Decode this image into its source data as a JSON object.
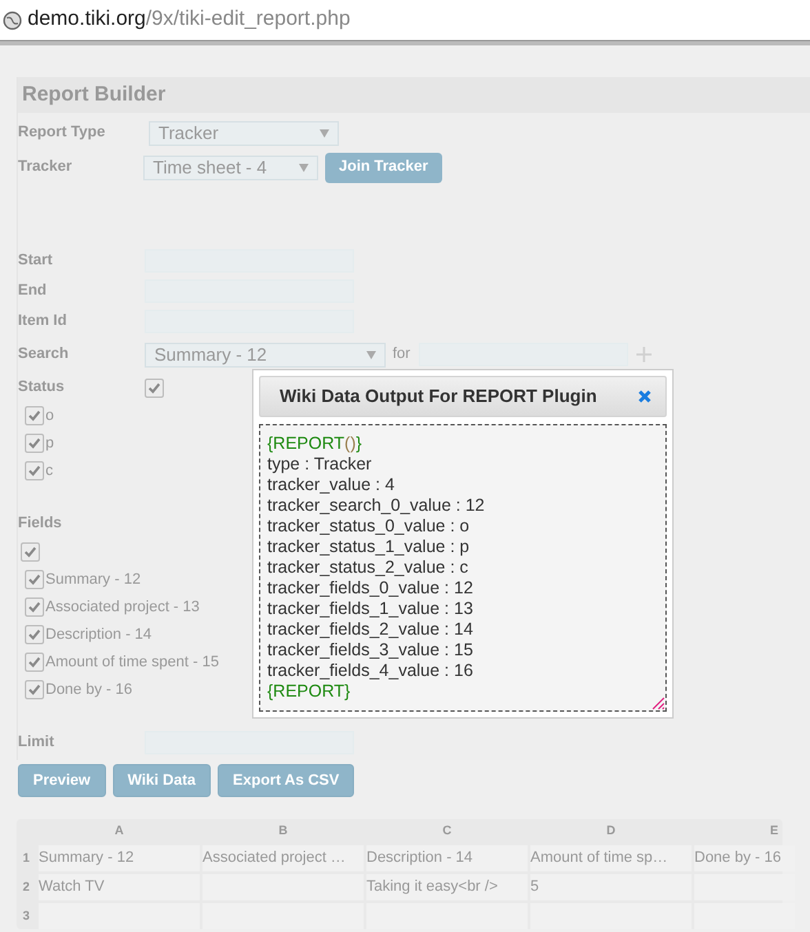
{
  "browser": {
    "url_host": "demo.tiki.org",
    "url_path": "/9x/tiki-edit_report.php"
  },
  "report_builder": {
    "title": "Report Builder",
    "sections": [
      [
        {
          "kind": "select",
          "label": "Report Type",
          "value": "Tracker"
        },
        {
          "kind": "select",
          "label": "Tracker",
          "value": "Time sheet - 4",
          "button": "Join Tracker"
        }
      ],
      [
        {
          "kind": "input",
          "label": "Start"
        },
        {
          "kind": "input",
          "label": "End"
        },
        {
          "kind": "input",
          "label": "Item Id"
        },
        {
          "kind": "search",
          "label": "Search",
          "value": "Summary - 12",
          "for_label": "for"
        },
        {
          "kind": "checks_inline",
          "label": "Status",
          "all_checked": true,
          "options": [
            {
              "label": "o",
              "checked": true
            },
            {
              "label": "p",
              "checked": true
            },
            {
              "label": "c",
              "checked": true
            }
          ]
        },
        {
          "kind": "checks_below",
          "label": "Fields",
          "all_checked": true,
          "options": [
            {
              "label": "Summary - 12",
              "checked": true
            },
            {
              "label": "Associated project - 13",
              "checked": true
            },
            {
              "label": "Description - 14",
              "checked": true
            },
            {
              "label": "Amount of time spent - 15",
              "checked": true
            },
            {
              "label": "Done by - 16",
              "checked": true
            }
          ]
        },
        {
          "kind": "input",
          "label": "Limit"
        }
      ]
    ]
  },
  "buttons": [
    "Preview",
    "Wiki Data",
    "Export As CSV"
  ],
  "spreadsheet": {
    "columns": [
      "A",
      "B",
      "C",
      "D",
      "E"
    ],
    "rows": [
      {
        "number": "1",
        "cells": [
          "Summary - 12",
          "Associated project …",
          "Description - 14",
          "Amount of time sp…",
          "Done by - 16"
        ]
      },
      {
        "number": "2",
        "cells": [
          "Watch TV",
          "",
          "Taking it easy<br />",
          "5",
          ""
        ]
      },
      {
        "number": "3",
        "cells": [
          "",
          "",
          "",
          "",
          ""
        ]
      }
    ]
  },
  "dialog": {
    "title": "Wiki Data Output For REPORT Plugin",
    "lines": [
      [
        {
          "kind": "tag",
          "text": "{REPORT"
        },
        {
          "kind": "paren",
          "text": "()"
        },
        {
          "kind": "tag",
          "text": "}"
        }
      ],
      [
        {
          "kind": "plain",
          "text": "type : Tracker"
        }
      ],
      [
        {
          "kind": "plain",
          "text": "tracker_value : 4"
        }
      ],
      [
        {
          "kind": "plain",
          "text": "tracker_search_0_value : 12"
        }
      ],
      [
        {
          "kind": "plain",
          "text": "tracker_status_0_value : o"
        }
      ],
      [
        {
          "kind": "plain",
          "text": "tracker_status_1_value : p"
        }
      ],
      [
        {
          "kind": "plain",
          "text": "tracker_status_2_value : c"
        }
      ],
      [
        {
          "kind": "plain",
          "text": "tracker_fields_0_value : 12"
        }
      ],
      [
        {
          "kind": "plain",
          "text": "tracker_fields_1_value : 13"
        }
      ],
      [
        {
          "kind": "plain",
          "text": "tracker_fields_2_value : 14"
        }
      ],
      [
        {
          "kind": "plain",
          "text": "tracker_fields_3_value : 15"
        }
      ],
      [
        {
          "kind": "plain",
          "text": "tracker_fields_4_value : 16"
        }
      ],
      [
        {
          "kind": "tag",
          "text": "{REPORT}"
        }
      ]
    ]
  }
}
